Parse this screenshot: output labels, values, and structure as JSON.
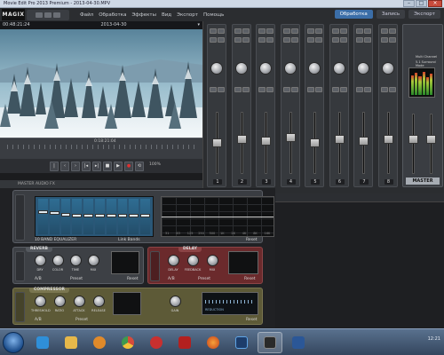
{
  "window": {
    "title": "Movie Edit Pro 2013 Premium - 2013-04-30.MPV",
    "controls": [
      "–",
      "□",
      "×"
    ]
  },
  "app": {
    "logo": "MAGIX"
  },
  "menu": {
    "items": [
      "Файл",
      "Обработка",
      "Эффекты",
      "Вид",
      "Экспорт",
      "Помощь"
    ]
  },
  "modes": {
    "tabs": [
      "Обработка",
      "Запись",
      "Экспорт"
    ],
    "active": 0
  },
  "preview": {
    "timecode": "00:48:21:24",
    "date": "2013-04-30",
    "position": "0:18:21:04"
  },
  "transport": {
    "buttons": [
      "|",
      "‹",
      "›",
      "|◂",
      "▸|",
      "■",
      "▶",
      "●",
      "⟲"
    ],
    "zoom": "100%"
  },
  "mixer": {
    "channel_numbers": [
      "1",
      "2",
      "3",
      "4",
      "5",
      "6",
      "7",
      "8"
    ],
    "master_label": "MASTER",
    "master_options": [
      "Multi Channel",
      "5.1 Surround Mode"
    ]
  },
  "rack": {
    "title": "MASTER AUDIO FX",
    "eq": {
      "name": "10 BAND EQUALIZER",
      "preset": "Link Bands",
      "reset": "Reset",
      "band_levels": [
        0.65,
        0.62,
        0.58,
        0.55,
        0.55,
        0.55,
        0.55,
        0.55,
        0.55,
        0.55
      ],
      "freqs": [
        "31",
        "63",
        "125",
        "250",
        "500",
        "1K",
        "2K",
        "4K",
        "8K",
        "16K"
      ]
    },
    "reverb": {
      "name": "REVERB",
      "knobs": [
        "DRY",
        "COLOR",
        "TIME",
        "MIX"
      ],
      "ab": "A/B",
      "preset": "Preset",
      "reset": "Reset"
    },
    "delay": {
      "name": "DELAY",
      "knobs": [
        "DELAY",
        "FEEDBACK",
        "MIX"
      ],
      "ab": "A/B",
      "preset": "Preset",
      "reset": "Reset"
    },
    "compressor": {
      "name": "COMPRESSOR",
      "knobs": [
        "THRESHOLD",
        "RATIO",
        "ATTACK",
        "RELEASE"
      ],
      "gain": "GAIN",
      "ab": "A/B",
      "preset": "Preset",
      "reset": "Reset",
      "readout": "REDUCTION"
    }
  },
  "taskbar": {
    "apps": [
      "ie",
      "folder",
      "media",
      "chrome",
      "opera",
      "acrobat",
      "firefox",
      "photoshop",
      "magix",
      "word"
    ],
    "active": [
      8
    ],
    "clock": "12:21"
  },
  "colors": {
    "accent": "#3b6ea8",
    "reverb": "#3d4045",
    "delay": "#6b2a2c",
    "compressor": "#5d5a37"
  }
}
